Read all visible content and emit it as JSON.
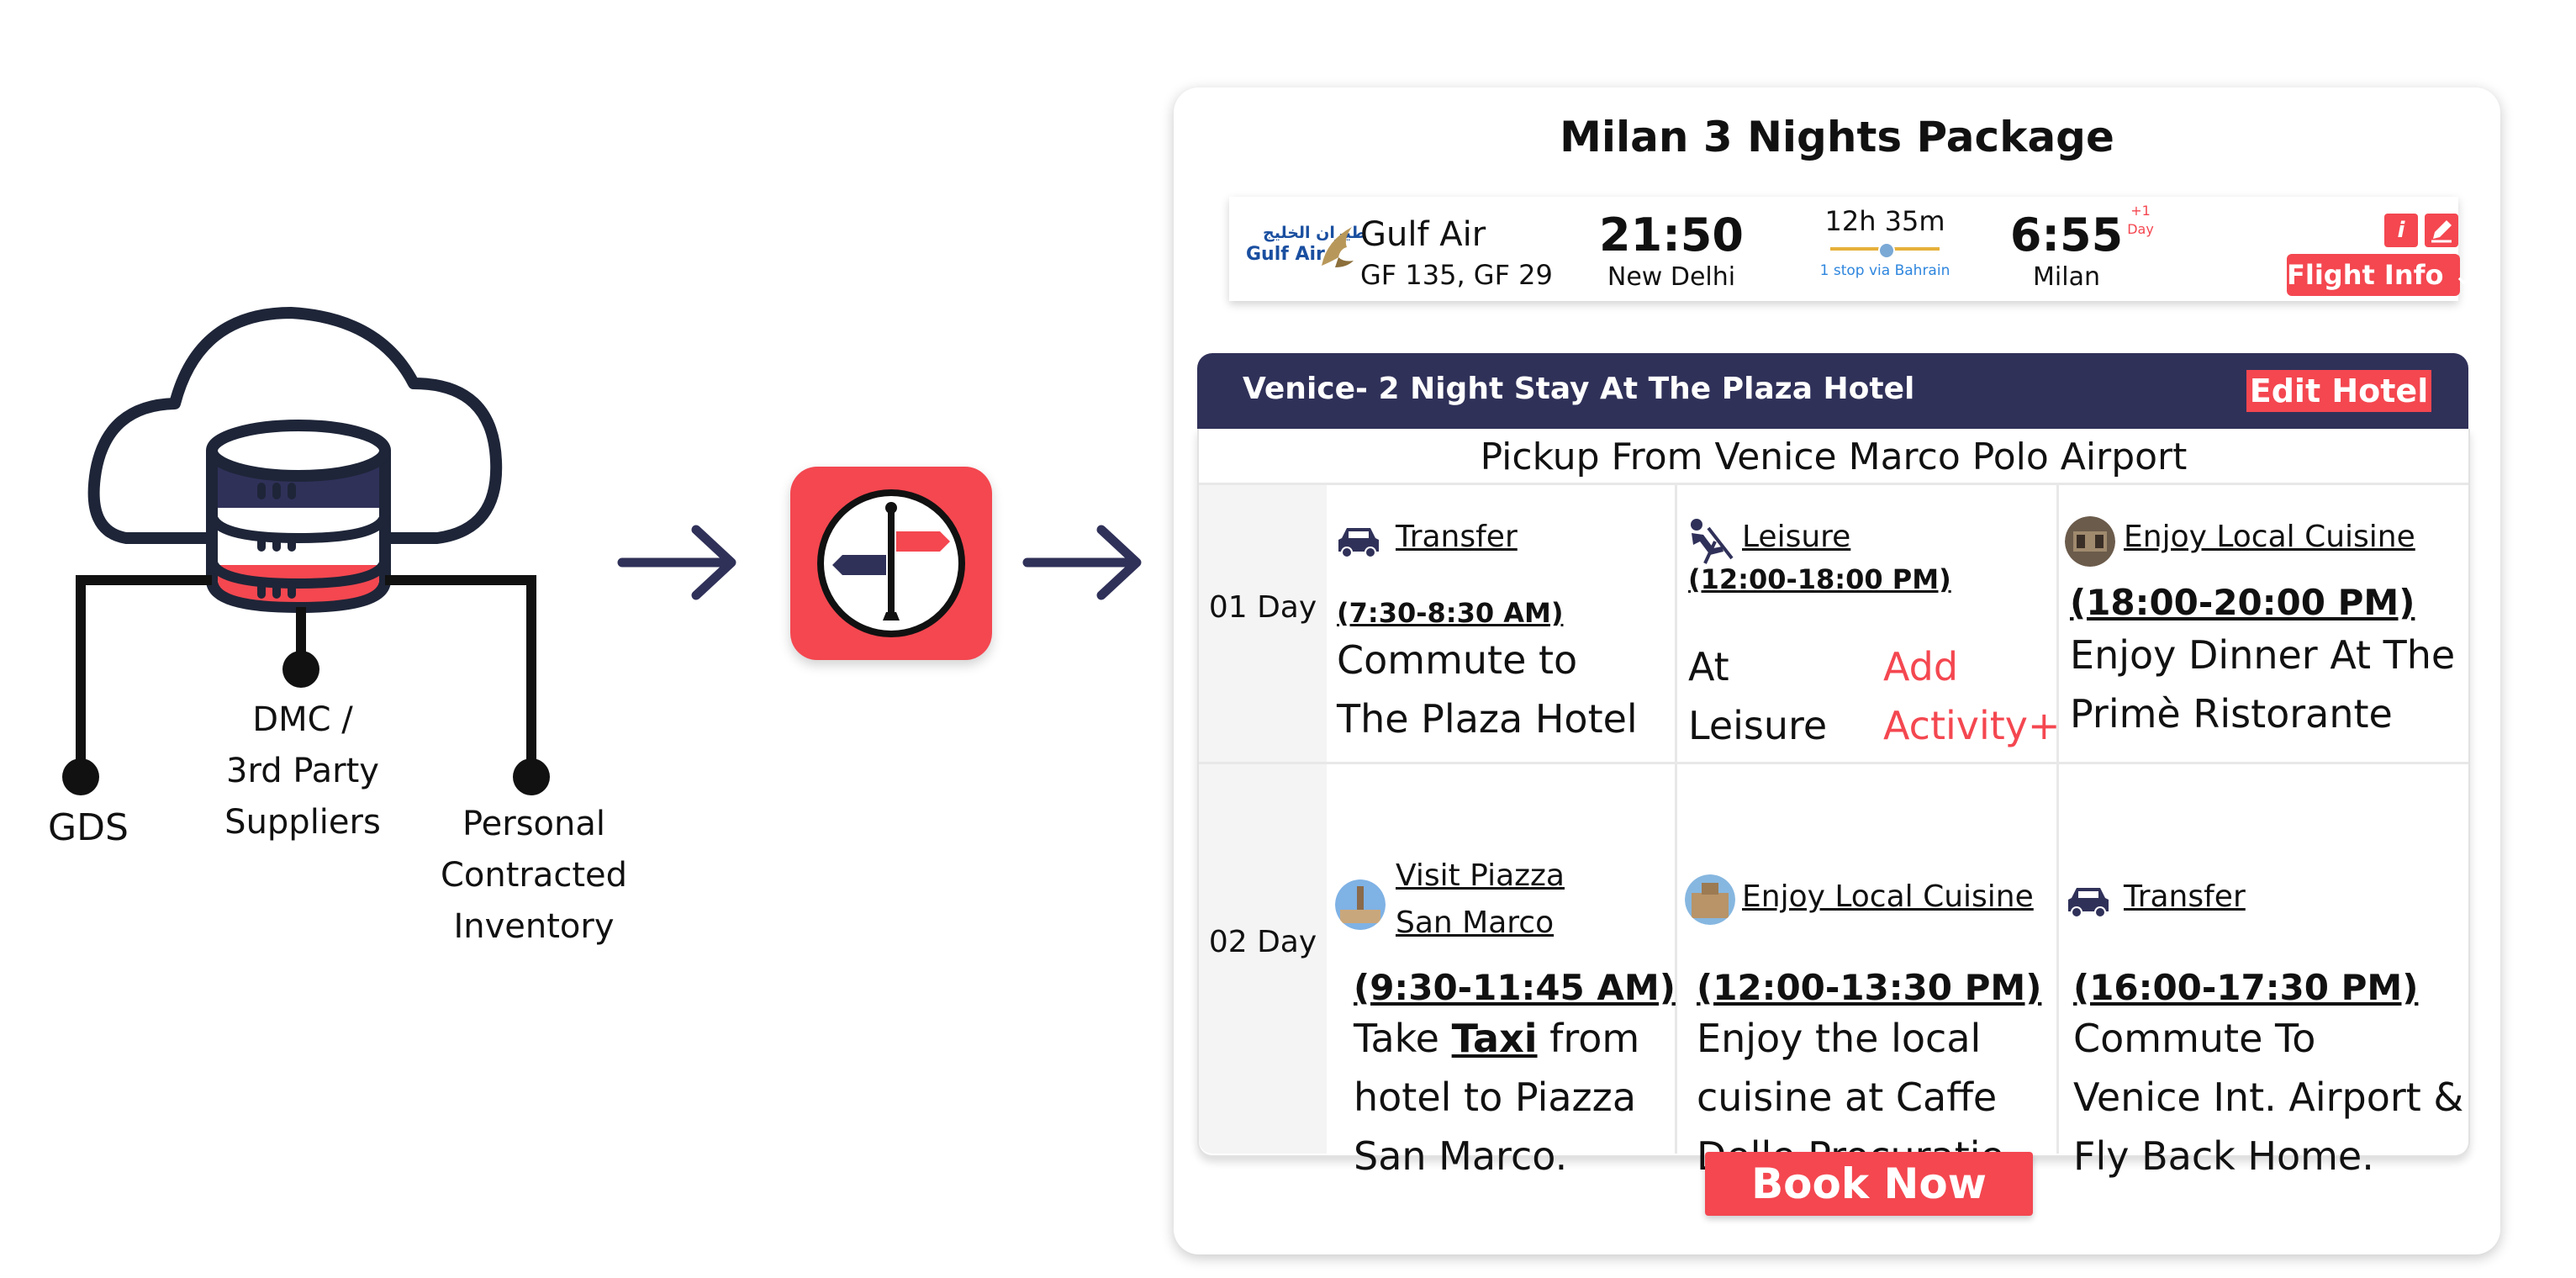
{
  "sources": {
    "gds_label": "GDS",
    "dmc_lines": [
      "DMC /",
      "3rd Party",
      "Suppliers"
    ],
    "personal_lines": [
      "Personal",
      "Contracted",
      "Inventory"
    ]
  },
  "package": {
    "title": "Milan 3 Nights Package",
    "flight": {
      "airline_logo_arabic": "طيران الخليج",
      "airline_logo_english": "Gulf Air",
      "airline": "Gulf Air",
      "flight_numbers": "GF 135, GF 29",
      "departure_time": "21:50",
      "departure_city": "New Delhi",
      "duration": "12h 35m",
      "stops": "1 stop via Bahrain",
      "arrival_time": "6:55",
      "arrival_offset_lines": [
        "+1",
        "Day"
      ],
      "arrival_city": "Milan",
      "info_label": "i",
      "flight_info_label": "Flight Info ⌄"
    },
    "hotel": {
      "title": "Venice- 2 Night Stay At The Plaza Hotel",
      "edit_label": "Edit Hotel"
    },
    "pickup": "Pickup From Venice Marco Polo Airport",
    "days": [
      {
        "label": "01 Day",
        "activities": [
          {
            "name": "Transfer",
            "icon": "car-icon",
            "time": "(7:30-8:30 AM)",
            "description_lines": [
              "Commute to",
              "The Plaza Hotel"
            ]
          },
          {
            "name": "Leisure",
            "icon": "leisure-icon",
            "time": "(12:00-18:00 PM)",
            "description_lines": [
              "At",
              "Leisure"
            ],
            "add_activity_lines": [
              "Add",
              "Activity+"
            ]
          },
          {
            "name": "Enjoy Local Cuisine",
            "icon": "restaurant-photo",
            "time": "(18:00-20:00 PM)",
            "description_lines": [
              "Enjoy Dinner At The",
              "Primè Ristorante"
            ]
          }
        ]
      },
      {
        "label": "02 Day",
        "activities": [
          {
            "name_lines": [
              "Visit Piazza",
              "San Marco"
            ],
            "icon": "piazza-photo",
            "time": "(9:30-11:45 AM)",
            "description_parts": [
              "Take ",
              "Taxi",
              " from"
            ],
            "description_lines": [
              "hotel to Piazza",
              "San Marco."
            ]
          },
          {
            "name": "Enjoy Local Cuisine",
            "icon": "cafe-photo",
            "time": "(12:00-13:30 PM)",
            "description_lines": [
              "Enjoy the local",
              "cuisine at Caffe",
              "Delle Procuratie."
            ]
          },
          {
            "name": "Transfer",
            "icon": "car-icon",
            "time": "(16:00-17:30 PM)",
            "description_lines": [
              "Commute To",
              "Venice Int. Airport &",
              "Fly Back Home."
            ]
          }
        ]
      }
    ],
    "book_label": "Book Now"
  },
  "colors": {
    "accent": "#f44750",
    "navy": "#303159",
    "outline": "#1e2538"
  }
}
